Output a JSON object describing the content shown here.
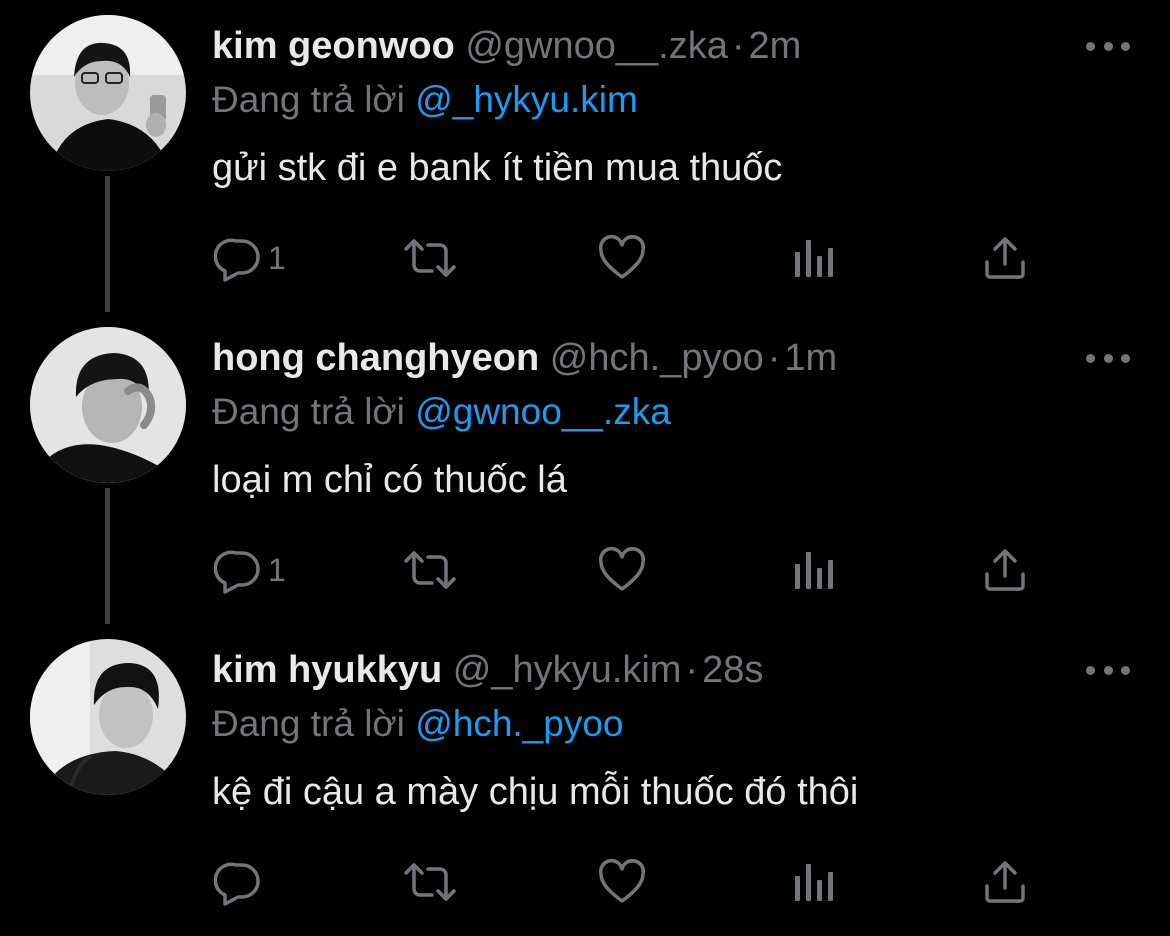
{
  "tweets": [
    {
      "name": "kim geonwoo",
      "handle": "@gwnoo__.zka",
      "dot": "·",
      "time": "2m",
      "reply_prefix": "Đang trả lời",
      "reply_to": "@_hykyu.kim",
      "text": "gửi stk đi e bank ít tiền mua thuốc",
      "reply_count": "1",
      "icons": [
        "reply-icon",
        "retweet-icon",
        "like-icon",
        "analytics-icon",
        "share-icon",
        "more-icon"
      ]
    },
    {
      "name": "hong changhyeon",
      "handle": "@hch._pyoo",
      "dot": "·",
      "time": "1m",
      "reply_prefix": "Đang trả lời",
      "reply_to": "@gwnoo__.zka",
      "text": "loại m chỉ có thuốc lá",
      "reply_count": "1",
      "icons": [
        "reply-icon",
        "retweet-icon",
        "like-icon",
        "analytics-icon",
        "share-icon",
        "more-icon"
      ]
    },
    {
      "name": "kim hyukkyu",
      "handle": "@_hykyu.kim",
      "dot": "·",
      "time": "28s",
      "reply_prefix": "Đang trả lời",
      "reply_to": "@hch._pyoo",
      "text": "kệ đi cậu a mày chịu mỗi thuốc đó thôi",
      "reply_count": "",
      "icons": [
        "reply-icon",
        "retweet-icon",
        "like-icon",
        "analytics-icon",
        "share-icon",
        "more-icon"
      ]
    }
  ],
  "colors": {
    "background": "#000000",
    "text_primary": "#e7e9ea",
    "text_secondary": "#71767b",
    "link": "#1d9bf0",
    "thread_line": "#3e4144"
  }
}
